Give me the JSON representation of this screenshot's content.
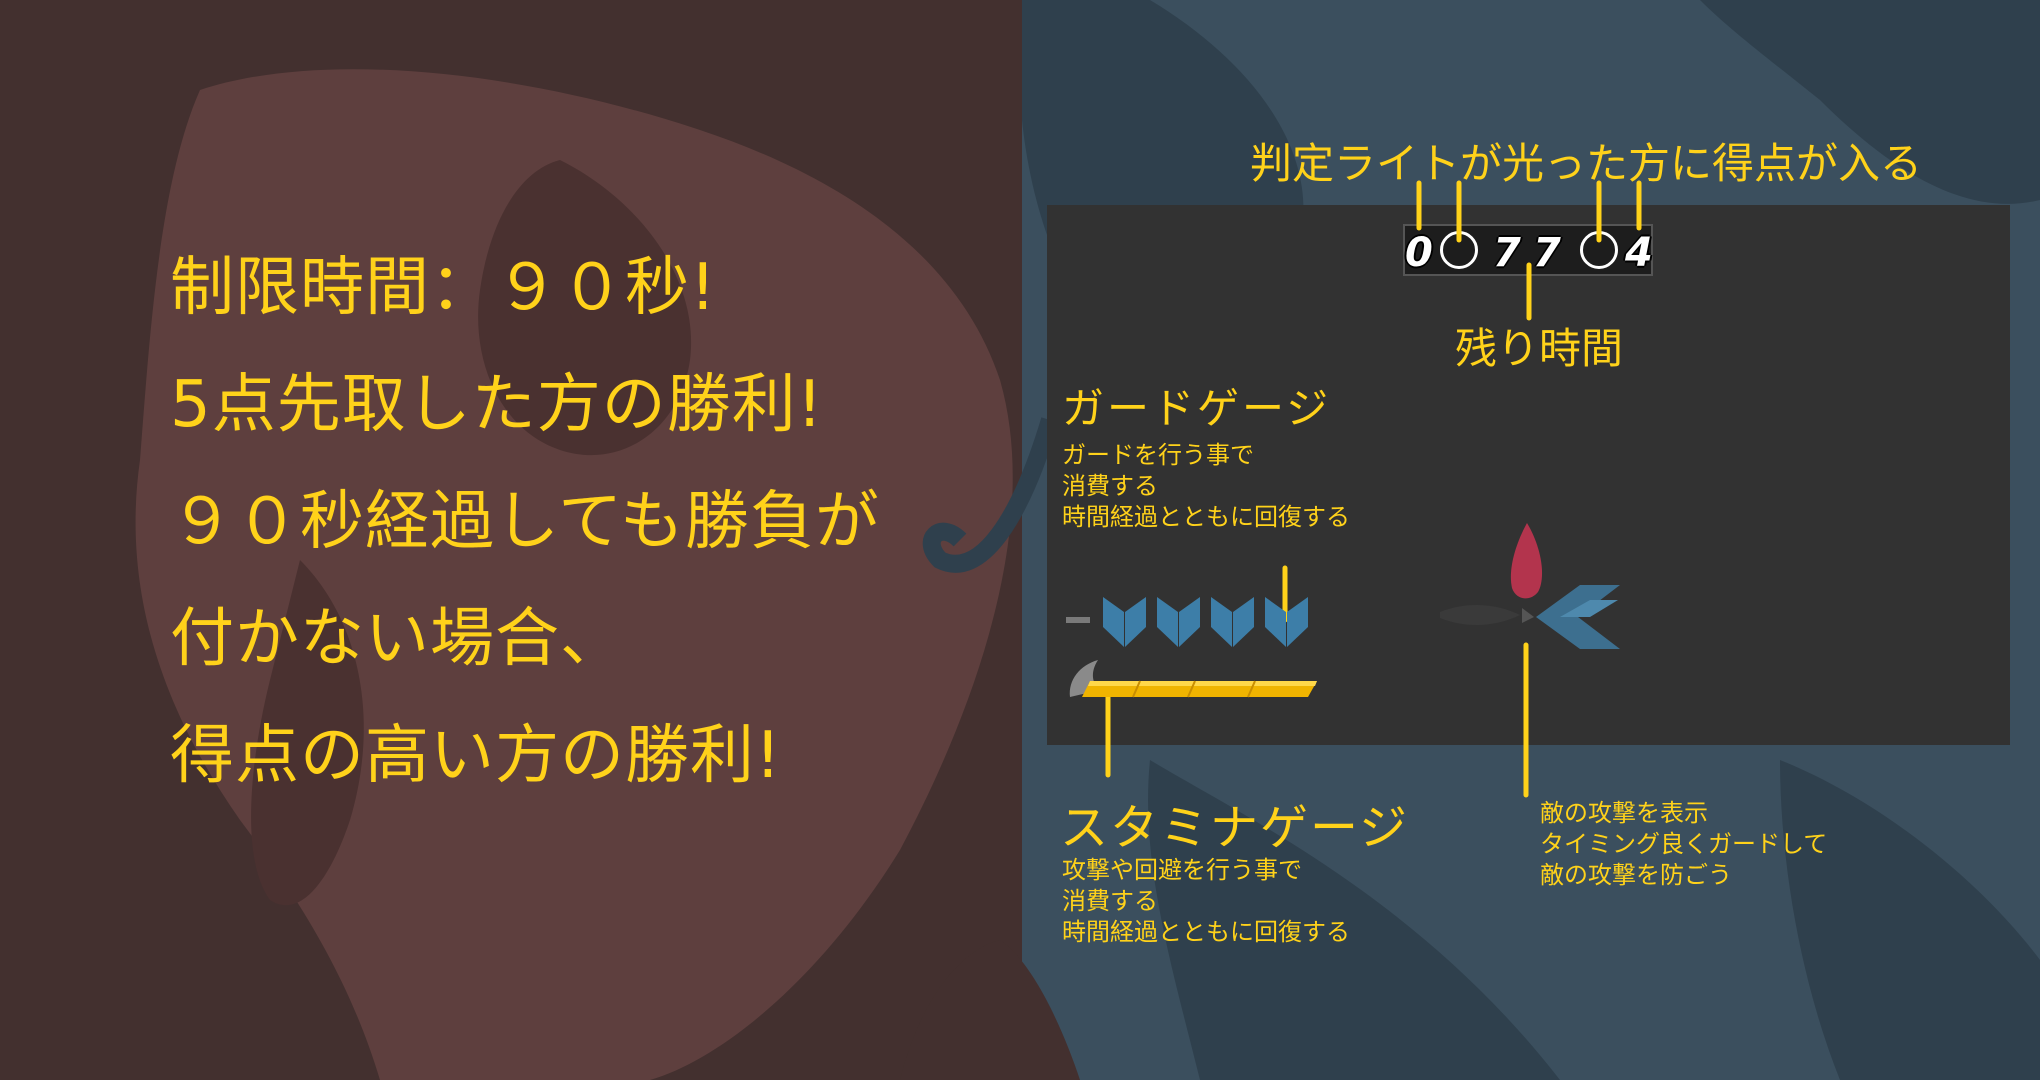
{
  "rules": {
    "lines": [
      "制限時間：９０秒!",
      "5点先取した方の勝利!",
      "９０秒経過しても勝負が",
      "付かない場合、",
      "得点の高い方の勝利!"
    ]
  },
  "hud": {
    "left_score": "0",
    "timer_digit_1": "7",
    "timer_digit_2": "7",
    "right_score": "4",
    "remaining_seconds": 77
  },
  "annotations": {
    "score_light_title": "判定ライトが光った方に得点が入る",
    "timer_title": "残り時間",
    "guard_title": "ガードゲージ",
    "guard_desc": [
      "ガードを行う事で",
      "消費する",
      "時間経過とともに回復する"
    ],
    "stamina_title": "スタミナゲージ",
    "stamina_desc": [
      "攻撃や回避を行う事で",
      "消費する",
      "時間経過とともに回復する"
    ],
    "enemy_desc": [
      "敵の攻撃を表示",
      "タイミング良くガードして",
      "敵の攻撃を防ごう"
    ]
  },
  "colors": {
    "accent_yellow": "#ffd21a",
    "left_bg": "#5e3f3e",
    "right_bg": "#3b4f5e",
    "panel": "#323232",
    "guard_arrow_blue": "#3d7ea8",
    "attack_red": "#b3344d"
  },
  "icons": {
    "guard_pips": "blue-chevron-shield-icons",
    "stamina_bar": "yellow-stamina-bar",
    "enemy_attack": "red-feather-and-blue-arrow-indicator"
  }
}
